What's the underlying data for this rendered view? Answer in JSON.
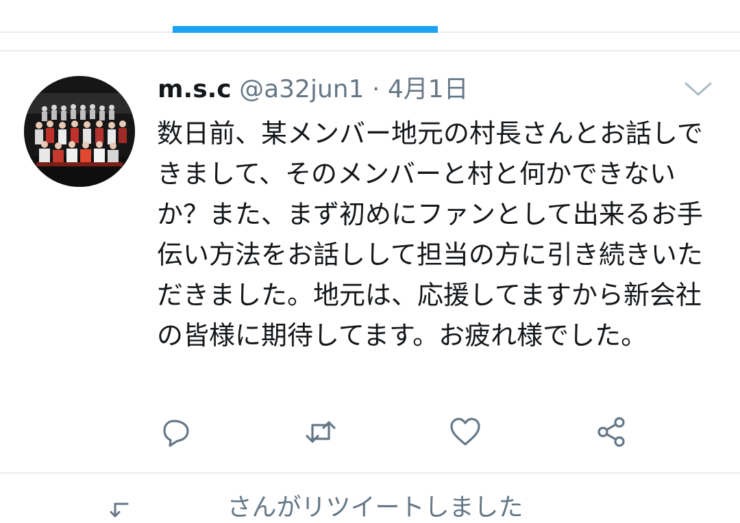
{
  "tweet": {
    "author_name": "m.s.c",
    "handle": "@a32jun1",
    "separator": " · ",
    "date": "4月1日",
    "text": "数日前、某メンバー地元の村長さんとお話しできまして、そのメンバーと村と何かできないか？また、まず初めにファンとして出来るお手伝い方法をお話しして担当の方に引き続きいただきました。地元は、応援してますから新会社の皆様に期待してます。お疲れ様でした。"
  },
  "actions": [
    "reply-icon",
    "retweet-icon",
    "like-icon",
    "share-icon"
  ],
  "next_tweet": {
    "context_text": "さんがリツイートしました"
  },
  "colors": {
    "accent": "#1da1f2",
    "text": "#14171a",
    "secondary": "#657786",
    "divider": "#e6ecf0"
  }
}
